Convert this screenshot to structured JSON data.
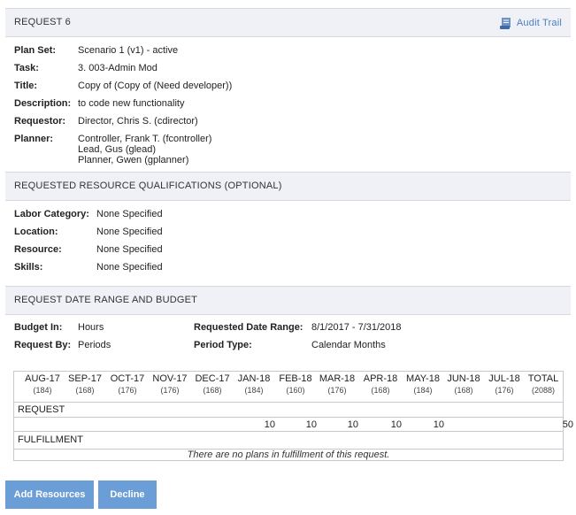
{
  "request": {
    "title": "REQUEST 6",
    "audit_trail_label": "Audit Trail",
    "fields": [
      {
        "label": "Plan Set:",
        "value": "Scenario 1 (v1) - active"
      },
      {
        "label": "Task:",
        "value": "3. 003-Admin Mod"
      },
      {
        "label": "Title:",
        "value": "Copy of (Copy of (Need developer))"
      },
      {
        "label": "Description:",
        "value": "to code new functionality"
      },
      {
        "label": "Requestor:",
        "value": "Director, Chris S. (cdirector)"
      }
    ],
    "planner_label": "Planner:",
    "planners": [
      "Controller, Frank T. (fcontroller)",
      "Lead, Gus (glead)",
      "Planner, Gwen (gplanner)"
    ]
  },
  "qualifications": {
    "title": "REQUESTED RESOURCE QUALIFICATIONS (OPTIONAL)",
    "fields": [
      {
        "label": "Labor Category:",
        "value": "None Specified"
      },
      {
        "label": "Location:",
        "value": "None Specified"
      },
      {
        "label": "Resource:",
        "value": "None Specified"
      },
      {
        "label": "Skills:",
        "value": "None Specified"
      }
    ]
  },
  "budget": {
    "title": "REQUEST DATE RANGE AND BUDGET",
    "budget_in_label": "Budget In:",
    "budget_in_value": "Hours",
    "request_by_label": "Request By:",
    "request_by_value": "Periods",
    "date_range_label": "Requested Date Range:",
    "date_range_value": "8/1/2017 - 7/31/2018",
    "period_type_label": "Period Type:",
    "period_type_value": "Calendar Months"
  },
  "grid": {
    "months": [
      {
        "name": "AUG-17",
        "hours": "(184)"
      },
      {
        "name": "SEP-17",
        "hours": "(168)"
      },
      {
        "name": "OCT-17",
        "hours": "(176)"
      },
      {
        "name": "NOV-17",
        "hours": "(176)"
      },
      {
        "name": "DEC-17",
        "hours": "(168)"
      },
      {
        "name": "JAN-18",
        "hours": "(184)"
      },
      {
        "name": "FEB-18",
        "hours": "(160)"
      },
      {
        "name": "MAR-18",
        "hours": "(176)"
      },
      {
        "name": "APR-18",
        "hours": "(168)"
      },
      {
        "name": "MAY-18",
        "hours": "(184)"
      },
      {
        "name": "JUN-18",
        "hours": "(168)"
      },
      {
        "name": "JUL-18",
        "hours": "(176)"
      },
      {
        "name": "TOTAL",
        "hours": "(2088)"
      }
    ],
    "request_label": "REQUEST",
    "request_values": [
      "",
      "",
      "",
      "",
      "",
      "10",
      "10",
      "10",
      "10",
      "10",
      "",
      "",
      "50"
    ],
    "fulfillment_label": "FULFILLMENT",
    "empty_message": "There are no plans in fulfillment of this request."
  },
  "actions": {
    "add_resources": "Add Resources",
    "decline": "Decline"
  },
  "colors": {
    "header_bg": "#f0f0f7",
    "link": "#4a7fc1",
    "button_bg": "#6b9dd6"
  }
}
